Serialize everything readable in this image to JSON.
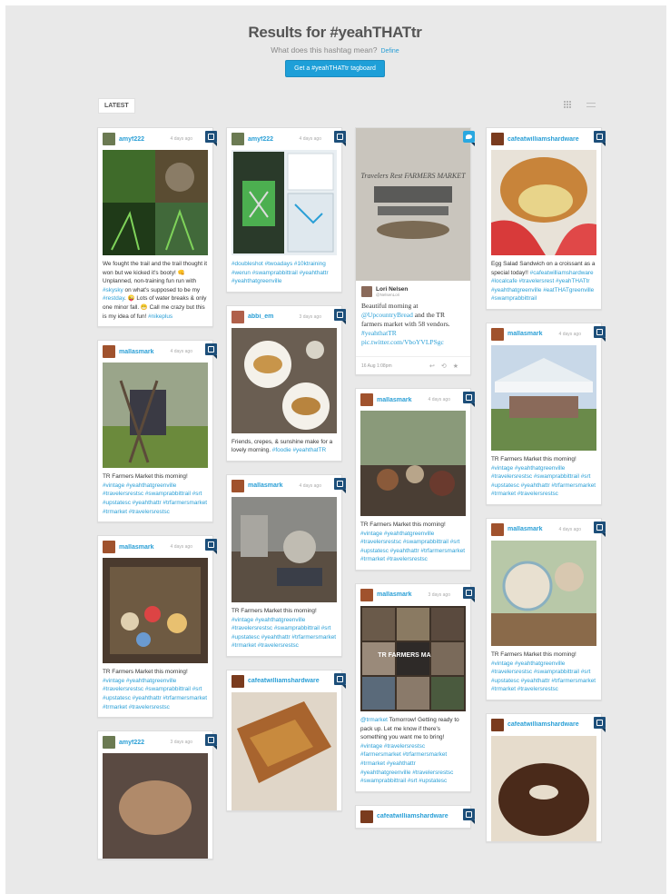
{
  "header": {
    "title": "Results for #yeahTHATtr",
    "subtitle": "What does this hashtag mean?",
    "define_link": "Define",
    "tagboard_button": "Get a #yeahTHATtr tagboard"
  },
  "filter": {
    "latest_label": "LATEST"
  },
  "icons": {
    "grid_view": "grid-icon",
    "list_view": "list-icon",
    "instagram": "instagram-icon",
    "twitter": "twitter-icon"
  },
  "colors": {
    "accent": "#2a9fd6",
    "button": "#1e9fd8",
    "instagram_badge": "#1d4f7a",
    "twitter_badge": "#2aa8e0",
    "background": "#e9e9e9"
  },
  "columns": [
    [
      {
        "user": "amyf222",
        "time": "4 days ago",
        "source": "instagram",
        "text": "We fought the trail and the trail thought it won but we kicked it's booty! 👊 Unplanned, non-training fun run with ",
        "tags1": "#skysky",
        "text2": " on what's supposed to be my ",
        "tags2": "#restday",
        "text3": ". 😜 Lots of water breaks & only one minor fall. 😁 Call me crazy but this is my idea of fun! ",
        "tags3": "#nikeplus"
      },
      {
        "user": "mallasmark",
        "time": "4 days ago",
        "source": "instagram",
        "text": "TR Farmers Market this morning! ",
        "tags1": "#vintage #yeahthatgreenville #travelersrestsc #swamprabbittrail #srt #upstatesc #yeahthattr #trfarmersmarket #trmarket #travelersrestsc"
      },
      {
        "user": "mallasmark",
        "time": "4 days ago",
        "source": "instagram",
        "text": "TR Farmers Market this morning! ",
        "tags1": "#vintage #yeahthatgreenville #travelersrestsc #swamprabbittrail #srt #upstatesc #yeahthattr #trfarmersmarket #trmarket #travelersrestsc"
      },
      {
        "user": "amyf222",
        "time": "3 days ago",
        "source": "instagram",
        "text": "",
        "tags1": ""
      }
    ],
    [
      {
        "user": "amyf222",
        "time": "4 days ago",
        "source": "instagram",
        "text": "",
        "tags1": "#doubleshot #twoadays #10ktraining #werun #swamprabbittrail #yeahthattr #yeahthatgreenville"
      },
      {
        "user": "abbi_em",
        "time": "3 days ago",
        "source": "instagram",
        "text": "Friends, crepes, & sunshine make for a lovely morning. ",
        "tags1": "#foodie #yeahthatTR"
      },
      {
        "user": "mallasmark",
        "time": "4 days ago",
        "source": "instagram",
        "text": "TR Farmers Market this morning! ",
        "tags1": "#vintage #yeahthatgreenville #travelersrestsc #swamprabbittrail #srt #upstatesc #yeahthattr #trfarmersmarket #trmarket #travelersrestsc"
      },
      {
        "user": "cafeatwilliamshardware",
        "time": "",
        "source": "instagram",
        "text": "",
        "tags1": ""
      }
    ],
    [
      {
        "user": "Lori Nelsen",
        "handle": "@NelsenLori",
        "source": "twitter",
        "image_text": "Travelers Rest FARMERS MARKET",
        "text": "Beautiful morning at ",
        "tags1": "@UpcountryBread",
        "text2": " and the TR farmers market with 58 vendors. ",
        "tags2": "#yeahthatTR pic.twitter.com/VboYVLPSgc",
        "date": "16 Aug 1:08pm"
      },
      {
        "user": "mallasmark",
        "time": "4 days ago",
        "source": "instagram",
        "text": "TR Farmers Market this morning! ",
        "tags1": "#vintage #yeahthatgreenville #travelersrestsc #swamprabbittrail #srt #upstatesc #yeahthattr #trfarmersmarket #trmarket #travelersrestsc"
      },
      {
        "user": "mallasmark",
        "time": "3 days ago",
        "source": "instagram",
        "image_text": "TR FARMERS MARKET",
        "tags0": "@trmarket",
        "text": " Tomorrow! Getting ready to pack up. Let me know if there's something you want me to bring! ",
        "tags1": "#vintage #travelersrestsc #farmersmarket #trfarmersmarket #trmarket #yeahthattr #yeahthatgreenville #travelersrestsc #swamprabbittrail #srt #upstatesc"
      },
      {
        "user": "cafeatwilliamshardware",
        "time": "",
        "source": "instagram",
        "text": "",
        "tags1": ""
      }
    ],
    [
      {
        "user": "cafeatwilliamshardware",
        "time": "",
        "source": "instagram",
        "text": "Egg Salad Sandwich on a croissant as a special today!! ",
        "tags1": "#cafeatwilliamshardware #localcafe #travelersrest #yeahTHATtr #yeahthatgreenville #eatTHATgreenville #swamprabbittrail"
      },
      {
        "user": "mallasmark",
        "time": "4 days ago",
        "source": "instagram",
        "text": "TR Farmers Market this morning! ",
        "tags1": "#vintage #yeahthatgreenville #travelersrestsc #swamprabbittrail #srt #upstatesc #yeahthattr #trfarmersmarket #trmarket #travelersrestsc"
      },
      {
        "user": "mallasmark",
        "time": "4 days ago",
        "source": "instagram",
        "text": "TR Farmers Market this morning! ",
        "tags1": "#vintage #yeahthatgreenville #travelersrestsc #swamprabbittrail #srt #upstatesc #yeahthattr #trfarmersmarket #trmarket #travelersrestsc"
      },
      {
        "user": "cafeatwilliamshardware",
        "time": "",
        "source": "instagram",
        "text": "",
        "tags1": ""
      }
    ]
  ]
}
